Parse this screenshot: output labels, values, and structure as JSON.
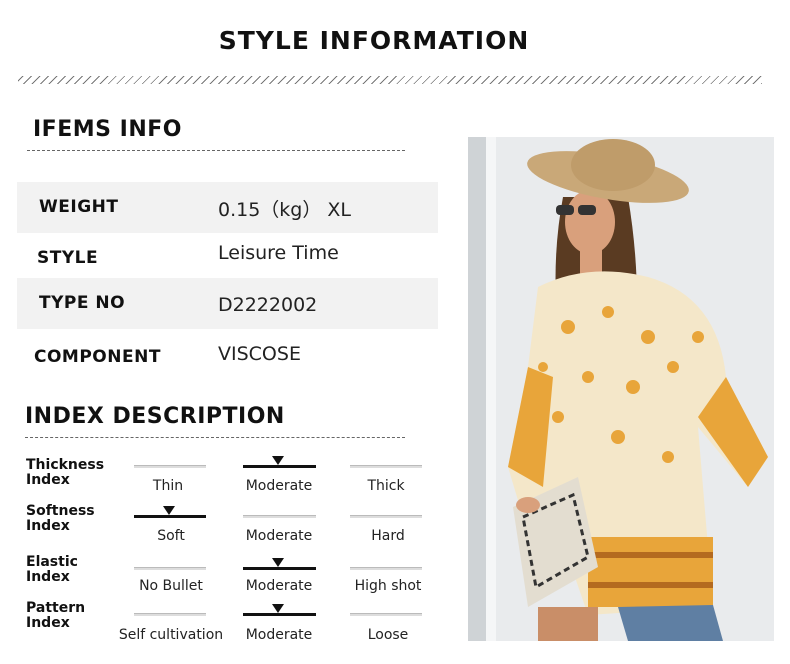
{
  "header": {
    "title": "STYLE INFORMATION"
  },
  "items_info": {
    "title": "IFEMS INFO",
    "rows": [
      {
        "label": "WEIGHT",
        "value": "0.15（kg） XL"
      },
      {
        "label": "STYLE",
        "value": "Leisure Time"
      },
      {
        "label": "TYPE NO",
        "value": "D2222002"
      },
      {
        "label": "COMPONENT",
        "value": "VISCOSE"
      }
    ]
  },
  "index_description": {
    "title": "INDEX DESCRIPTION",
    "indices": [
      {
        "label_line1": "Thickness",
        "label_line2": "Index",
        "options": [
          "Thin",
          "Moderate",
          "Thick"
        ],
        "selected": 1
      },
      {
        "label_line1": "Softness",
        "label_line2": "Index",
        "options": [
          "Soft",
          "Moderate",
          "Hard"
        ],
        "selected": 0
      },
      {
        "label_line1": "Elastic",
        "label_line2": "Index",
        "options": [
          "No Bullet",
          "Moderate",
          "High shot"
        ],
        "selected": 1
      },
      {
        "label_line1": "Pattern",
        "label_line2": "Index",
        "options": [
          "Self cultivation",
          "Moderate",
          "Loose"
        ],
        "selected": 1
      }
    ]
  },
  "colors": {
    "wall": "#e9ebed",
    "top": "#e8a53a",
    "shorts": "#5f7fa3",
    "hat": "#c9a878"
  }
}
